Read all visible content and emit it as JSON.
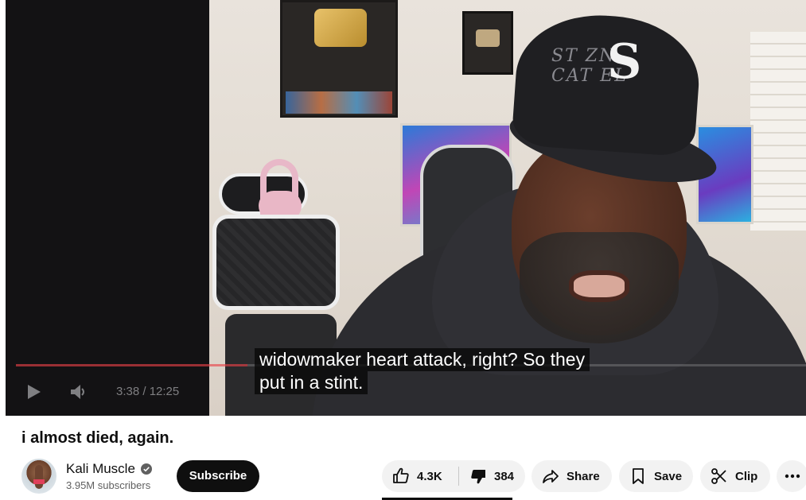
{
  "player": {
    "time_display": "3:38 / 12:25",
    "progress_fraction": 0.293,
    "captions": [
      "widowmaker heart attack, right? So they",
      "put in a stint."
    ],
    "progress_color": "#e8242b"
  },
  "video": {
    "title": "i almost died, again."
  },
  "channel": {
    "name": "Kali Muscle",
    "subscribers": "3.95M subscribers",
    "subscribe_label": "Subscribe",
    "verified_icon": "verified-check-icon"
  },
  "actions": {
    "likes": "4.3K",
    "dislikes": "384",
    "share_label": "Share",
    "save_label": "Save",
    "clip_label": "Clip"
  },
  "icons": {
    "play": "play-icon",
    "volume": "volume-icon",
    "like": "thumbs-up-icon",
    "dislike": "thumbs-down-icon",
    "share": "share-arrow-icon",
    "save": "bookmark-icon",
    "clip": "scissors-icon",
    "more": "more-horizontal-icon"
  }
}
